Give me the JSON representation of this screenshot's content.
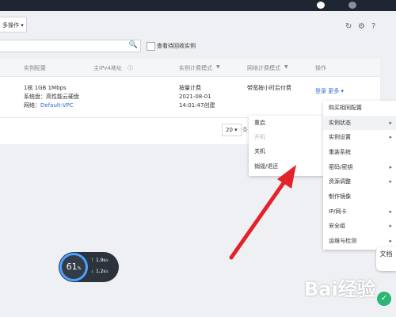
{
  "toolbar": {
    "bulk_label": "多操作",
    "bulk_chevron": "▾"
  },
  "icons": {
    "refresh": "↻",
    "settings": "⚙",
    "help": "?",
    "search": "🔍",
    "chevron_right": "▸"
  },
  "filter": {
    "recycle_checkbox_label": "查看待回收实例"
  },
  "table": {
    "headers": {
      "config": "实例配置",
      "ip": "主IPv4地址",
      "ip_info": "ⓘ",
      "billing": "实例计费模式",
      "billing_filter": "▼",
      "net_billing": "网络计费模式",
      "net_filter": "▼",
      "actions": "操作"
    },
    "row": {
      "config": [
        "1核 1GB 1Mbps",
        "系统盘：高性能云硬盘"
      ],
      "network_label": "网络：",
      "network_link": "Default-VPC",
      "billing": [
        "按量计费",
        "2021-08-01",
        "14:01:47创建"
      ],
      "net_billing": "带宽按小时后付费",
      "login": "登录",
      "more": "更多 ▾"
    }
  },
  "pagination": {
    "page_size": "20",
    "page_size_chevron": "▾",
    "partial": "条"
  },
  "main_menu": [
    {
      "label": "购买相同配置",
      "submenu": false
    },
    {
      "label": "实例状态",
      "submenu": true
    },
    {
      "label": "实例设置",
      "submenu": true
    },
    {
      "label": "重装系统",
      "submenu": false
    },
    {
      "label": "密码/密钥",
      "submenu": true
    },
    {
      "label": "资源调整",
      "submenu": true
    },
    {
      "label": "制作镜像",
      "submenu": false
    },
    {
      "label": "IP/网卡",
      "submenu": true
    },
    {
      "label": "安全组",
      "submenu": true
    },
    {
      "label": "运维与检测",
      "submenu": true
    }
  ],
  "sub_menu": [
    {
      "label": "重启",
      "disabled": false
    },
    {
      "label": "开机",
      "disabled": true
    },
    {
      "label": "关机",
      "disabled": false
    },
    {
      "label": "销毁/退还",
      "disabled": false
    }
  ],
  "gauge": {
    "percent": "61",
    "unit": "%",
    "up": "1.9",
    "up_unit": "K/s",
    "down": "1.2",
    "down_unit": "K/s"
  },
  "doc_tab": "文档",
  "watermark": "Bai经验",
  "colors": {
    "link": "#2a6cd2",
    "arrow": "#e3232c",
    "topbar": "#1f2633"
  }
}
